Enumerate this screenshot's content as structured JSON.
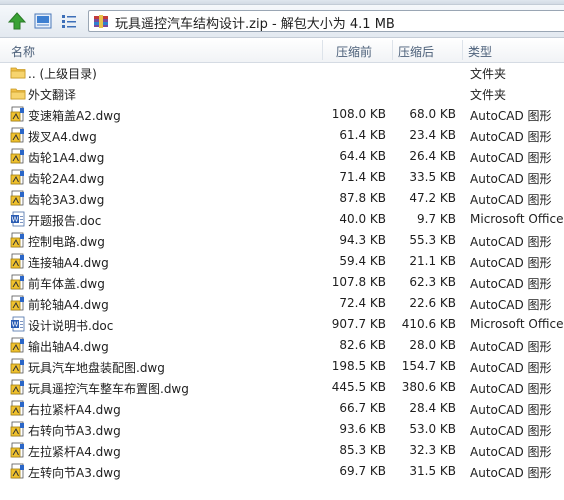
{
  "window": {
    "path": "玩具遥控汽车结构设计.zip - 解包大小为 4.1 MB"
  },
  "columns": {
    "name": "名称",
    "size": "压缩前",
    "packed": "压缩后",
    "type": "类型"
  },
  "files": [
    {
      "name": ".. (上级目录)",
      "size": "",
      "packed": "",
      "type": "文件夹",
      "icon": "folder"
    },
    {
      "name": "外文翻译",
      "size": "",
      "packed": "",
      "type": "文件夹",
      "icon": "folder"
    },
    {
      "name": "变速箱盖A2.dwg",
      "size": "108.0 KB",
      "packed": "68.0 KB",
      "type": "AutoCAD 图形",
      "icon": "dwg"
    },
    {
      "name": "拨叉A4.dwg",
      "size": "61.4 KB",
      "packed": "23.4 KB",
      "type": "AutoCAD 图形",
      "icon": "dwg"
    },
    {
      "name": "齿轮1A4.dwg",
      "size": "64.4 KB",
      "packed": "26.4 KB",
      "type": "AutoCAD 图形",
      "icon": "dwg"
    },
    {
      "name": "齿轮2A4.dwg",
      "size": "71.4 KB",
      "packed": "33.5 KB",
      "type": "AutoCAD 图形",
      "icon": "dwg"
    },
    {
      "name": "齿轮3A3.dwg",
      "size": "87.8 KB",
      "packed": "47.2 KB",
      "type": "AutoCAD 图形",
      "icon": "dwg"
    },
    {
      "name": "开题报告.doc",
      "size": "40.0 KB",
      "packed": "9.7 KB",
      "type": "Microsoft Office",
      "icon": "doc"
    },
    {
      "name": "控制电路.dwg",
      "size": "94.3 KB",
      "packed": "55.3 KB",
      "type": "AutoCAD 图形",
      "icon": "dwg"
    },
    {
      "name": "连接轴A4.dwg",
      "size": "59.4 KB",
      "packed": "21.1 KB",
      "type": "AutoCAD 图形",
      "icon": "dwg"
    },
    {
      "name": "前车体盖.dwg",
      "size": "107.8 KB",
      "packed": "62.3 KB",
      "type": "AutoCAD 图形",
      "icon": "dwg"
    },
    {
      "name": "前轮轴A4.dwg",
      "size": "72.4 KB",
      "packed": "22.6 KB",
      "type": "AutoCAD 图形",
      "icon": "dwg"
    },
    {
      "name": "设计说明书.doc",
      "size": "907.7 KB",
      "packed": "410.6 KB",
      "type": "Microsoft Office",
      "icon": "doc"
    },
    {
      "name": "输出轴A4.dwg",
      "size": "82.6 KB",
      "packed": "28.0 KB",
      "type": "AutoCAD 图形",
      "icon": "dwg"
    },
    {
      "name": "玩具汽车地盘装配图.dwg",
      "size": "198.5 KB",
      "packed": "154.7 KB",
      "type": "AutoCAD 图形",
      "icon": "dwg"
    },
    {
      "name": "玩具遥控汽车整车布置图.dwg",
      "size": "445.5 KB",
      "packed": "380.6 KB",
      "type": "AutoCAD 图形",
      "icon": "dwg"
    },
    {
      "name": "右拉紧杆A4.dwg",
      "size": "66.7 KB",
      "packed": "28.4 KB",
      "type": "AutoCAD 图形",
      "icon": "dwg"
    },
    {
      "name": "右转向节A3.dwg",
      "size": "93.6 KB",
      "packed": "53.0 KB",
      "type": "AutoCAD 图形",
      "icon": "dwg"
    },
    {
      "name": "左拉紧杆A4.dwg",
      "size": "85.3 KB",
      "packed": "32.3 KB",
      "type": "AutoCAD 图形",
      "icon": "dwg"
    },
    {
      "name": "左转向节A3.dwg",
      "size": "69.7 KB",
      "packed": "31.5 KB",
      "type": "AutoCAD 图形",
      "icon": "dwg"
    }
  ],
  "colors": {
    "header_text": "#4c607a",
    "up_arrow": "#3aa235",
    "folder": "#f2c14a"
  }
}
